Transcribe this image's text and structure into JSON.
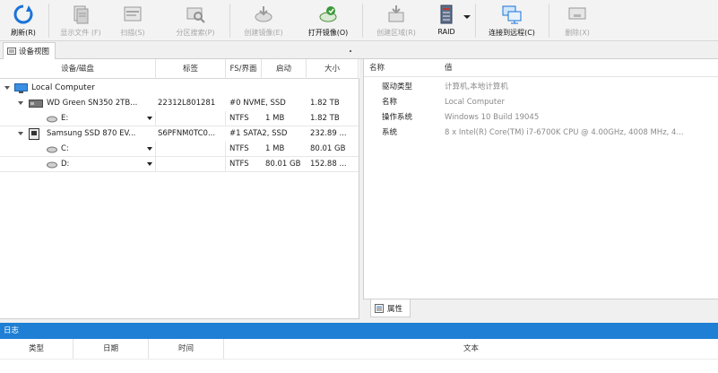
{
  "toolbar": {
    "buttons": [
      {
        "label": "刷新(R)",
        "icon": "refresh-icon",
        "enabled": true
      },
      {
        "label": "显示文件 (F)",
        "icon": "show-files-icon",
        "enabled": false
      },
      {
        "label": "扫描(S)",
        "icon": "scan-icon",
        "enabled": false
      },
      {
        "label": "分区搜索(P)",
        "icon": "partition-search-icon",
        "enabled": false
      },
      {
        "label": "创建镜像(E)",
        "icon": "create-image-icon",
        "enabled": false
      },
      {
        "label": "打开镜像(O)",
        "icon": "open-image-icon",
        "enabled": true
      },
      {
        "label": "创建区域(R)",
        "icon": "create-region-icon",
        "enabled": false
      },
      {
        "label": "RAID",
        "icon": "raid-icon",
        "enabled": true
      },
      {
        "label": "连接到远程(C)",
        "icon": "connect-remote-icon",
        "enabled": true
      },
      {
        "label": "删除(X)",
        "icon": "delete-icon",
        "enabled": false
      }
    ]
  },
  "tabs": {
    "device_view": "设备视图"
  },
  "device_table": {
    "columns": [
      "设备/磁盘",
      "标签",
      "FS/界面",
      "启动",
      "大小"
    ],
    "root": {
      "name": "Local Computer"
    },
    "disks": [
      {
        "name": "WD Green SN350 2TB...",
        "label": "22312L801281",
        "fs": "#0 NVME, SSD",
        "start": "",
        "size": "1.82 TB",
        "partitions": [
          {
            "name": "E:",
            "label": "",
            "fs": "NTFS",
            "start": "1 MB",
            "size": "1.82 TB"
          }
        ]
      },
      {
        "name": "Samsung SSD 870 EV...",
        "label": "S6PFNM0TC0...",
        "fs": "#1 SATA2, SSD",
        "start": "",
        "size": "232.89 ...",
        "partitions": [
          {
            "name": "C:",
            "label": "",
            "fs": "NTFS",
            "start": "1 MB",
            "size": "80.01 GB"
          },
          {
            "name": "D:",
            "label": "",
            "fs": "NTFS",
            "start": "80.01 GB",
            "size": "152.88 ..."
          }
        ]
      }
    ]
  },
  "properties": {
    "columns": [
      "名称",
      "值"
    ],
    "rows": [
      {
        "name": "驱动类型",
        "value": "计算机,本地计算机"
      },
      {
        "name": "名称",
        "value": "Local Computer"
      },
      {
        "name": "操作系统",
        "value": "Windows 10 Build 19045"
      },
      {
        "name": "系统",
        "value": "8 x Intel(R) Core(TM) i7-6700K CPU @ 4.00GHz, 4008 MHz, 4..."
      }
    ],
    "tab_label": "属性"
  },
  "log": {
    "title": "日志",
    "columns": [
      "类型",
      "日期",
      "时间",
      "文本"
    ]
  },
  "colors": {
    "accent": "#1f7fd4",
    "disabled_text": "#a8a8a8"
  }
}
